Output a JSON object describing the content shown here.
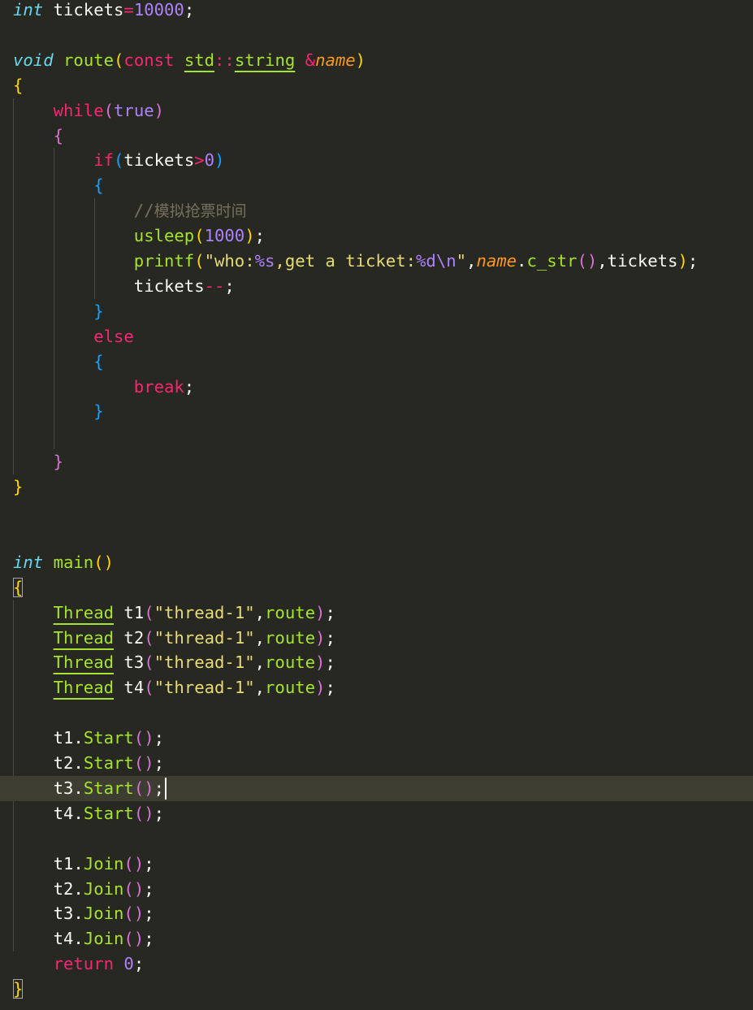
{
  "lines": [
    [
      {
        "t": "int",
        "c": "type"
      },
      {
        "t": " tickets",
        "c": "id"
      },
      {
        "t": "=",
        "c": "op"
      },
      {
        "t": "10000",
        "c": "num"
      },
      {
        "t": ";",
        "c": "id"
      }
    ],
    [],
    [
      {
        "t": "void",
        "c": "type"
      },
      {
        "t": " ",
        "c": "id"
      },
      {
        "t": "route",
        "c": "fn"
      },
      {
        "t": "(",
        "c": "b1"
      },
      {
        "t": "const",
        "c": "kw"
      },
      {
        "t": " ",
        "c": "id"
      },
      {
        "t": "std",
        "c": "ns"
      },
      {
        "t": "::",
        "c": "op"
      },
      {
        "t": "string",
        "c": "ns"
      },
      {
        "t": " ",
        "c": "id"
      },
      {
        "t": "&",
        "c": "op"
      },
      {
        "t": "name",
        "c": "param"
      },
      {
        "t": ")",
        "c": "b1"
      }
    ],
    [
      {
        "t": "{",
        "c": "b1"
      }
    ],
    [
      {
        "t": "    ",
        "c": "id"
      },
      {
        "t": "while",
        "c": "kw"
      },
      {
        "t": "(",
        "c": "b2"
      },
      {
        "t": "true",
        "c": "const"
      },
      {
        "t": ")",
        "c": "b2"
      }
    ],
    [
      {
        "t": "    ",
        "c": "id"
      },
      {
        "t": "{",
        "c": "b2"
      }
    ],
    [
      {
        "t": "        ",
        "c": "id"
      },
      {
        "t": "if",
        "c": "kw"
      },
      {
        "t": "(",
        "c": "b3"
      },
      {
        "t": "tickets",
        "c": "id"
      },
      {
        "t": ">",
        "c": "op"
      },
      {
        "t": "0",
        "c": "num"
      },
      {
        "t": ")",
        "c": "b3"
      }
    ],
    [
      {
        "t": "        ",
        "c": "id"
      },
      {
        "t": "{",
        "c": "b3"
      }
    ],
    [
      {
        "t": "            ",
        "c": "id"
      },
      {
        "t": "//",
        "c": "cmt"
      },
      {
        "t": "模拟抢票时间",
        "c": "cmt cn"
      }
    ],
    [
      {
        "t": "            ",
        "c": "id"
      },
      {
        "t": "usleep",
        "c": "fn"
      },
      {
        "t": "(",
        "c": "b1"
      },
      {
        "t": "1000",
        "c": "num"
      },
      {
        "t": ")",
        "c": "b1"
      },
      {
        "t": ";",
        "c": "id"
      }
    ],
    [
      {
        "t": "            ",
        "c": "id"
      },
      {
        "t": "printf",
        "c": "fn"
      },
      {
        "t": "(",
        "c": "b1"
      },
      {
        "t": "\"who:",
        "c": "str"
      },
      {
        "t": "%s",
        "c": "esc"
      },
      {
        "t": ",get a ticket:",
        "c": "str"
      },
      {
        "t": "%d\\n",
        "c": "esc"
      },
      {
        "t": "\"",
        "c": "str"
      },
      {
        "t": ",",
        "c": "id"
      },
      {
        "t": "name",
        "c": "param"
      },
      {
        "t": ".",
        "c": "id"
      },
      {
        "t": "c_str",
        "c": "fn"
      },
      {
        "t": "(",
        "c": "b2"
      },
      {
        "t": ")",
        "c": "b2"
      },
      {
        "t": ",tickets",
        "c": "id"
      },
      {
        "t": ")",
        "c": "b1"
      },
      {
        "t": ";",
        "c": "id"
      }
    ],
    [
      {
        "t": "            ",
        "c": "id"
      },
      {
        "t": "tickets",
        "c": "id"
      },
      {
        "t": "--",
        "c": "op"
      },
      {
        "t": ";",
        "c": "id"
      }
    ],
    [
      {
        "t": "        ",
        "c": "id"
      },
      {
        "t": "}",
        "c": "b3"
      }
    ],
    [
      {
        "t": "        ",
        "c": "id"
      },
      {
        "t": "else",
        "c": "kw"
      }
    ],
    [
      {
        "t": "        ",
        "c": "id"
      },
      {
        "t": "{",
        "c": "b3"
      }
    ],
    [
      {
        "t": "            ",
        "c": "id"
      },
      {
        "t": "break",
        "c": "kw"
      },
      {
        "t": ";",
        "c": "id"
      }
    ],
    [
      {
        "t": "        ",
        "c": "id"
      },
      {
        "t": "}",
        "c": "b3"
      }
    ],
    [],
    [
      {
        "t": "    ",
        "c": "id"
      },
      {
        "t": "}",
        "c": "b2"
      }
    ],
    [
      {
        "t": "}",
        "c": "b1"
      }
    ],
    [],
    [],
    [
      {
        "t": "int",
        "c": "type"
      },
      {
        "t": " ",
        "c": "id"
      },
      {
        "t": "main",
        "c": "fn"
      },
      {
        "t": "()",
        "c": "b1"
      }
    ],
    [
      {
        "t": "{",
        "c": "b1 bhl"
      }
    ],
    [
      {
        "t": "    ",
        "c": "id"
      },
      {
        "t": "Thread",
        "c": "ns"
      },
      {
        "t": " t1",
        "c": "id"
      },
      {
        "t": "(",
        "c": "b2"
      },
      {
        "t": "\"thread-1\"",
        "c": "str"
      },
      {
        "t": ",",
        "c": "id"
      },
      {
        "t": "route",
        "c": "fn"
      },
      {
        "t": ")",
        "c": "b2"
      },
      {
        "t": ";",
        "c": "id"
      }
    ],
    [
      {
        "t": "    ",
        "c": "id"
      },
      {
        "t": "Thread",
        "c": "ns"
      },
      {
        "t": " t2",
        "c": "id"
      },
      {
        "t": "(",
        "c": "b2"
      },
      {
        "t": "\"thread-1\"",
        "c": "str"
      },
      {
        "t": ",",
        "c": "id"
      },
      {
        "t": "route",
        "c": "fn"
      },
      {
        "t": ")",
        "c": "b2"
      },
      {
        "t": ";",
        "c": "id"
      }
    ],
    [
      {
        "t": "    ",
        "c": "id"
      },
      {
        "t": "Thread",
        "c": "ns"
      },
      {
        "t": " t3",
        "c": "id"
      },
      {
        "t": "(",
        "c": "b2"
      },
      {
        "t": "\"thread-1\"",
        "c": "str"
      },
      {
        "t": ",",
        "c": "id"
      },
      {
        "t": "route",
        "c": "fn"
      },
      {
        "t": ")",
        "c": "b2"
      },
      {
        "t": ";",
        "c": "id"
      }
    ],
    [
      {
        "t": "    ",
        "c": "id"
      },
      {
        "t": "Thread",
        "c": "ns"
      },
      {
        "t": " t4",
        "c": "id"
      },
      {
        "t": "(",
        "c": "b2"
      },
      {
        "t": "\"thread-1\"",
        "c": "str"
      },
      {
        "t": ",",
        "c": "id"
      },
      {
        "t": "route",
        "c": "fn"
      },
      {
        "t": ")",
        "c": "b2"
      },
      {
        "t": ";",
        "c": "id"
      }
    ],
    [],
    [
      {
        "t": "    ",
        "c": "id"
      },
      {
        "t": "t1.",
        "c": "id"
      },
      {
        "t": "Start",
        "c": "fn"
      },
      {
        "t": "()",
        "c": "b2"
      },
      {
        "t": ";",
        "c": "id"
      }
    ],
    [
      {
        "t": "    ",
        "c": "id"
      },
      {
        "t": "t2.",
        "c": "id"
      },
      {
        "t": "Start",
        "c": "fn"
      },
      {
        "t": "()",
        "c": "b2"
      },
      {
        "t": ";",
        "c": "id"
      }
    ],
    [
      {
        "t": "    ",
        "c": "id"
      },
      {
        "t": "t3.",
        "c": "id"
      },
      {
        "t": "Start",
        "c": "fn"
      },
      {
        "t": "()",
        "c": "b2"
      },
      {
        "t": ";",
        "c": "id"
      }
    ],
    [
      {
        "t": "    ",
        "c": "id"
      },
      {
        "t": "t4.",
        "c": "id"
      },
      {
        "t": "Start",
        "c": "fn"
      },
      {
        "t": "()",
        "c": "b2"
      },
      {
        "t": ";",
        "c": "id"
      }
    ],
    [],
    [
      {
        "t": "    ",
        "c": "id"
      },
      {
        "t": "t1.",
        "c": "id"
      },
      {
        "t": "Join",
        "c": "fn"
      },
      {
        "t": "()",
        "c": "b2"
      },
      {
        "t": ";",
        "c": "id"
      }
    ],
    [
      {
        "t": "    ",
        "c": "id"
      },
      {
        "t": "t2.",
        "c": "id"
      },
      {
        "t": "Join",
        "c": "fn"
      },
      {
        "t": "()",
        "c": "b2"
      },
      {
        "t": ";",
        "c": "id"
      }
    ],
    [
      {
        "t": "    ",
        "c": "id"
      },
      {
        "t": "t3.",
        "c": "id"
      },
      {
        "t": "Join",
        "c": "fn"
      },
      {
        "t": "()",
        "c": "b2"
      },
      {
        "t": ";",
        "c": "id"
      }
    ],
    [
      {
        "t": "    ",
        "c": "id"
      },
      {
        "t": "t4.",
        "c": "id"
      },
      {
        "t": "Join",
        "c": "fn"
      },
      {
        "t": "()",
        "c": "b2"
      },
      {
        "t": ";",
        "c": "id"
      }
    ],
    [
      {
        "t": "    ",
        "c": "id"
      },
      {
        "t": "return",
        "c": "kw"
      },
      {
        "t": " ",
        "c": "id"
      },
      {
        "t": "0",
        "c": "num"
      },
      {
        "t": ";",
        "c": "id"
      }
    ],
    [
      {
        "t": "}",
        "c": "b1 bhl"
      }
    ]
  ],
  "cursor_line": 31,
  "theme": {
    "background": "#272822",
    "current_line": "#3e3d32",
    "keyword": "#f92672",
    "type": "#66d9ef",
    "function": "#a6e22e",
    "string": "#e6db74",
    "number": "#ae81ff",
    "parameter": "#fd971f",
    "comment": "#75715e"
  }
}
